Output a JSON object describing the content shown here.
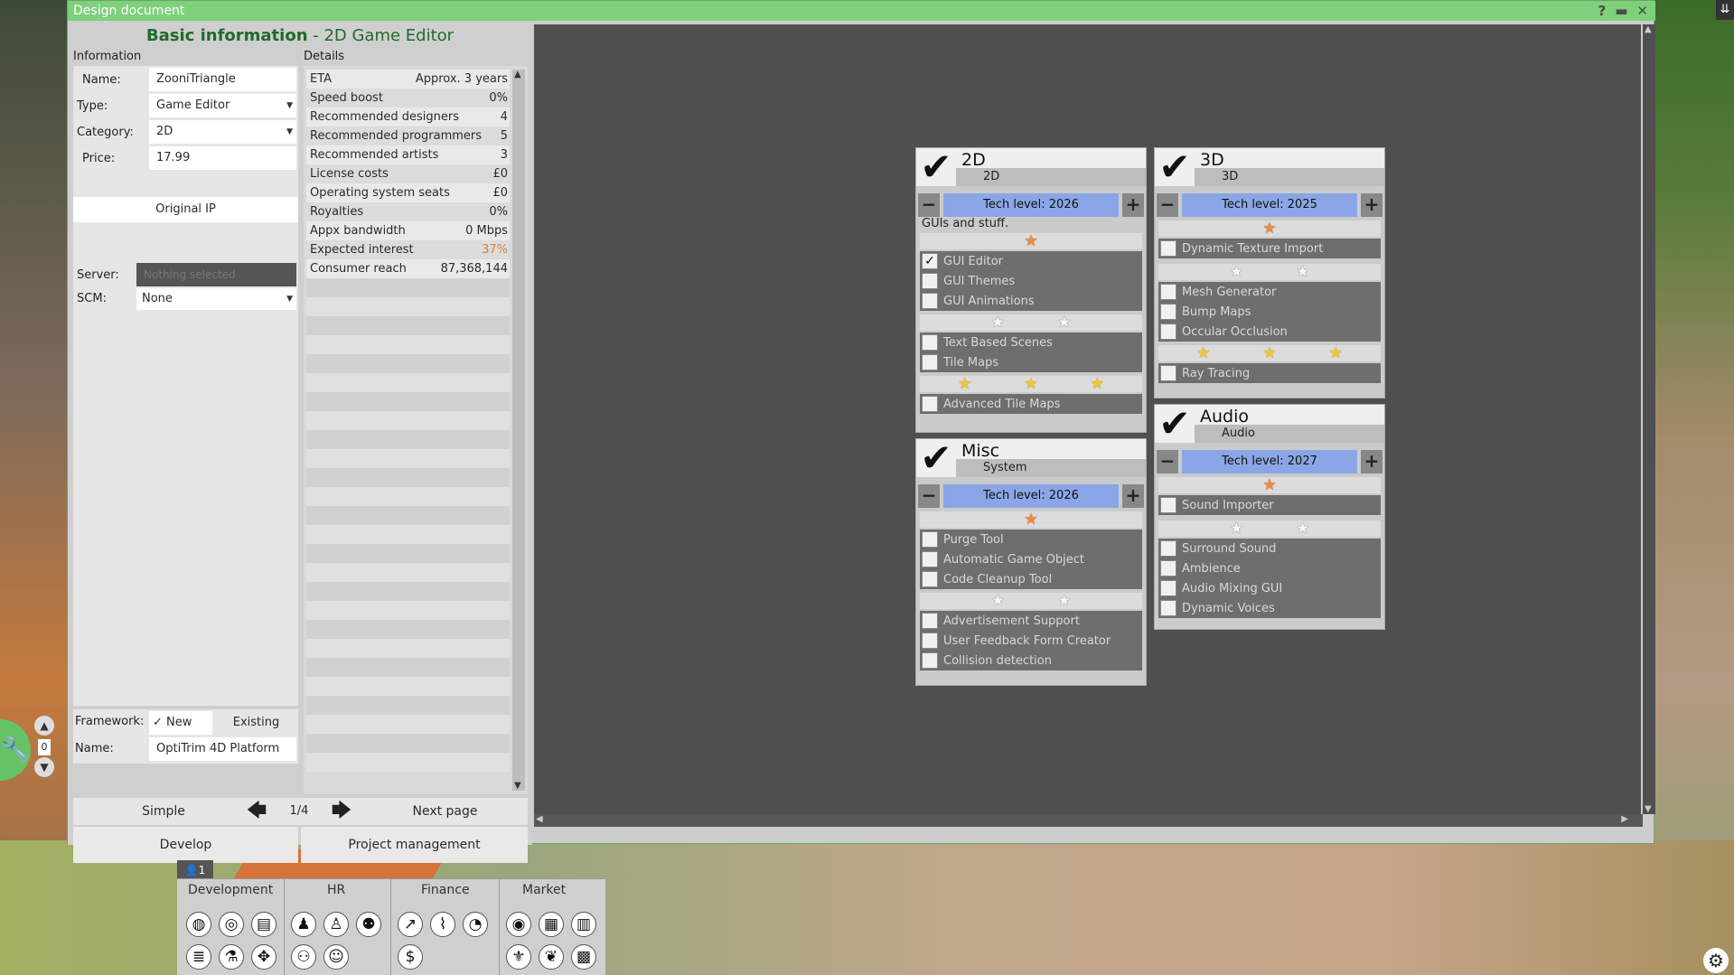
{
  "window": {
    "title": "Design document",
    "help": "?",
    "minimize": "▬",
    "close": "✕"
  },
  "panel": {
    "heading_bold": "Basic information",
    "heading_rest": " - 2D Game Editor",
    "info_label": "Information",
    "details_label": "Details"
  },
  "info": {
    "name_label": "Name:",
    "name_value": "ZooniTriangle",
    "type_label": "Type:",
    "type_value": "Game Editor",
    "category_label": "Category:",
    "category_value": "2D",
    "price_label": "Price:",
    "price_value": "17.99",
    "original_ip": "Original IP",
    "server_label": "Server:",
    "server_value": "Nothing selected",
    "scm_label": "SCM:",
    "scm_value": "None",
    "framework_label": "Framework:",
    "framework_new": "New",
    "framework_new_check": "✓",
    "framework_existing": "Existing",
    "fw_name_label": "Name:",
    "fw_name_value": "OptiTrim 4D Platform"
  },
  "details": [
    {
      "label": "ETA",
      "value": "Approx. 3 years"
    },
    {
      "label": "Speed boost",
      "value": "0%"
    },
    {
      "label": "Recommended designers",
      "value": "4"
    },
    {
      "label": "Recommended programmers",
      "value": "5"
    },
    {
      "label": "Recommended artists",
      "value": "3"
    },
    {
      "label": "License costs",
      "value": "£0"
    },
    {
      "label": "Operating system seats",
      "value": "£0"
    },
    {
      "label": "Royalties",
      "value": "0%"
    },
    {
      "label": "Appx bandwidth",
      "value": "0 Mbps"
    },
    {
      "label": "Expected interest",
      "value": "37%",
      "color": "#d9843a"
    },
    {
      "label": "Consumer reach",
      "value": "87,368,144"
    }
  ],
  "nav": {
    "simple": "Simple",
    "page": "1/4",
    "next": "Next page",
    "prev_arrow": "🡄",
    "next_arrow": "🡆"
  },
  "buttons": {
    "develop": "Develop",
    "project_management": "Project management"
  },
  "cards": {
    "c2d": {
      "title": "2D",
      "subtitle": "2D",
      "tech": "Tech level: 2026",
      "desc": "GUIs and stuff.",
      "f1": "GUI Editor",
      "f1_check": "✓",
      "f2": "GUI Themes",
      "f3": "GUI Animations",
      "f4": "Text Based Scenes",
      "f5": "Tile Maps",
      "f6": "Advanced Tile Maps"
    },
    "c3d": {
      "title": "3D",
      "subtitle": "3D",
      "tech": "Tech level: 2025",
      "f1": "Dynamic Texture Import",
      "f2": "Mesh Generator",
      "f3": "Bump Maps",
      "f4": "Occular Occlusion",
      "f5": "Ray Tracing"
    },
    "misc": {
      "title": "Misc",
      "subtitle": "System",
      "tech": "Tech level: 2026",
      "f1": "Purge Tool",
      "f2": "Automatic Game Object",
      "f3": "Code Cleanup Tool",
      "f4": "Advertisement Support",
      "f5": "User Feedback Form Creator",
      "f6": "Collision detection"
    },
    "audio": {
      "title": "Audio",
      "subtitle": "Audio",
      "tech": "Tech level: 2027",
      "f1": "Sound Importer",
      "f2": "Surround Sound",
      "f3": "Ambience",
      "f4": "Audio Mixing GUI",
      "f5": "Dynamic Voices"
    }
  },
  "toolbar": {
    "development": "Development",
    "hr": "HR",
    "finance": "Finance",
    "market": "Market",
    "counter": "1"
  },
  "left_widget": {
    "count": "0"
  }
}
